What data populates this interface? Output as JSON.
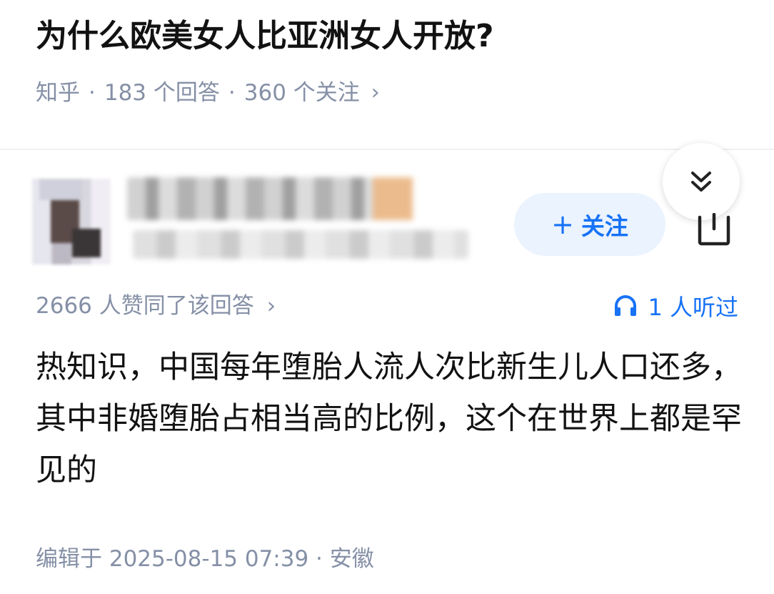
{
  "question": {
    "title": "为什么欧美女人比亚洲女人开放?",
    "source": "知乎",
    "answers": "183 个回答",
    "followers": "360 个关注",
    "separator": "·"
  },
  "author": {
    "follow_label": "关注",
    "follow_icon": "plus-icon"
  },
  "answer": {
    "vote_text": "2666 人赞同了该回答",
    "listen_text": "1 人听过",
    "content": "热知识，中国每年堕胎人流人次比新生儿人口还多，其中非婚堕胎占相当高的比例，这个在世界上都是罕见的",
    "edit_meta": "编辑于 2025-08-15 07:39 · 安徽"
  },
  "colors": {
    "accent": "#1772f6",
    "meta": "#8590a6",
    "text": "#121212"
  }
}
